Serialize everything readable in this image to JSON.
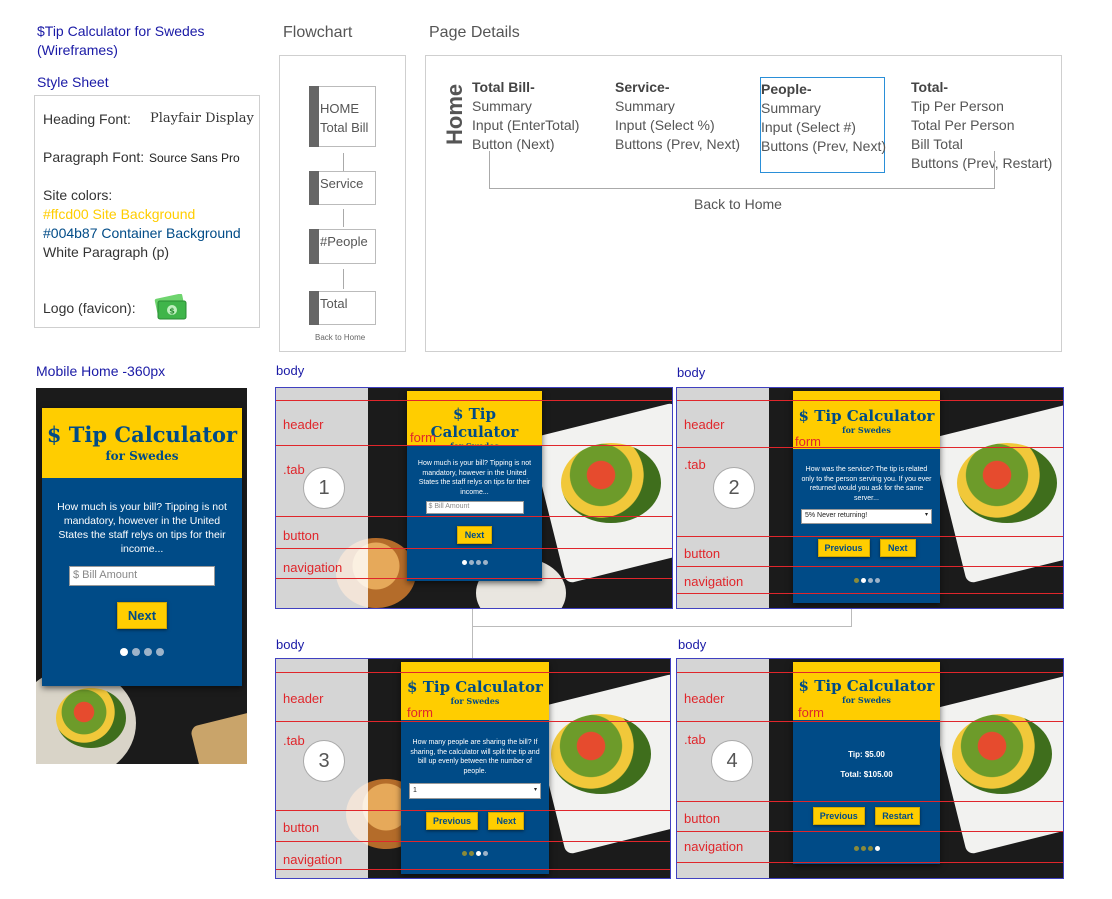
{
  "project": {
    "title_line1": "$Tip Calculator for Swedes",
    "title_line2": "(Wireframes)"
  },
  "style_sheet": {
    "label": "Style Sheet",
    "heading_font_label": "Heading Font:",
    "heading_font_value": "Playfair Display",
    "paragraph_font_label": "Paragraph Font:",
    "paragraph_font_value": "Source Sans Pro",
    "site_colors_label": "Site colors:",
    "color1": "#ffcd00 Site Background",
    "color2": "#004b87 Container Background",
    "color3": "White Paragraph (p)",
    "logo_label": "Logo (favicon):",
    "accent_yellow": "#ffcd00",
    "accent_blue": "#004b87"
  },
  "flowchart": {
    "label": "Flowchart",
    "box1_line1": "HOME",
    "box1_line2": "Total Bill",
    "box2": "Service",
    "box3": "#People",
    "box4": "Total",
    "back": "Back to Home"
  },
  "page_details": {
    "label": "Page Details",
    "side_label": "Home",
    "total_bill": {
      "heading": "Total Bill-",
      "l1": "Summary",
      "l2": "Input (EnterTotal)",
      "l3": "Button (Next)"
    },
    "service": {
      "heading": "Service-",
      "l1": "Summary",
      "l2": "Input (Select %)",
      "l3": "Buttons (Prev, Next)"
    },
    "people": {
      "heading": "People-",
      "l1": "Summary",
      "l2": "Input (Select #)",
      "l3": "Buttons (Prev, Next)"
    },
    "total": {
      "heading": "Total-",
      "l1": "Tip Per Person",
      "l2": "Total Per Person",
      "l3": "Bill Total",
      "l4": "Buttons (Prev, Restart)"
    },
    "back": "Back to Home"
  },
  "mobile": {
    "label": "Mobile Home -360px",
    "title": "$ Tip Calculator",
    "subtitle": "for Swedes",
    "text": "How much is your bill? Tipping is not mandatory, however in the United States the staff relys on tips for their income...",
    "input_placeholder": "$ Bill Amount",
    "next": "Next"
  },
  "wire_labels": {
    "body": "body",
    "header": "header",
    "form": "form",
    "tab": ".tab",
    "button": "button",
    "navigation": "navigation"
  },
  "screens": {
    "s1": {
      "number": "1",
      "title": "$ Tip Calculator",
      "subtitle": "for Swedes",
      "text": "How much is your bill? Tipping is not mandatory, however in the United States the staff relys on tips for their income...",
      "input_placeholder": "$ Bill Amount",
      "next": "Next"
    },
    "s2": {
      "number": "2",
      "title": "$ Tip Calculator",
      "subtitle": "for Swedes",
      "text": "How was the service? The tip is related only to the person serving you. If you ever returned would you ask for the same server...",
      "select_value": "5% Never returning!",
      "prev": "Previous",
      "next": "Next"
    },
    "s3": {
      "number": "3",
      "title": "$ Tip Calculator",
      "subtitle": "for Swedes",
      "text": "How many people are sharing the bill? If sharing, the calculator will split the tip and bill up evenly between the number of people.",
      "select_value": "1",
      "prev": "Previous",
      "next": "Next"
    },
    "s4": {
      "number": "4",
      "title": "$ Tip Calculator",
      "subtitle": "for Swedes",
      "tip": "Tip: $5.00",
      "total": "Total: $105.00",
      "prev": "Previous",
      "restart": "Restart"
    }
  }
}
